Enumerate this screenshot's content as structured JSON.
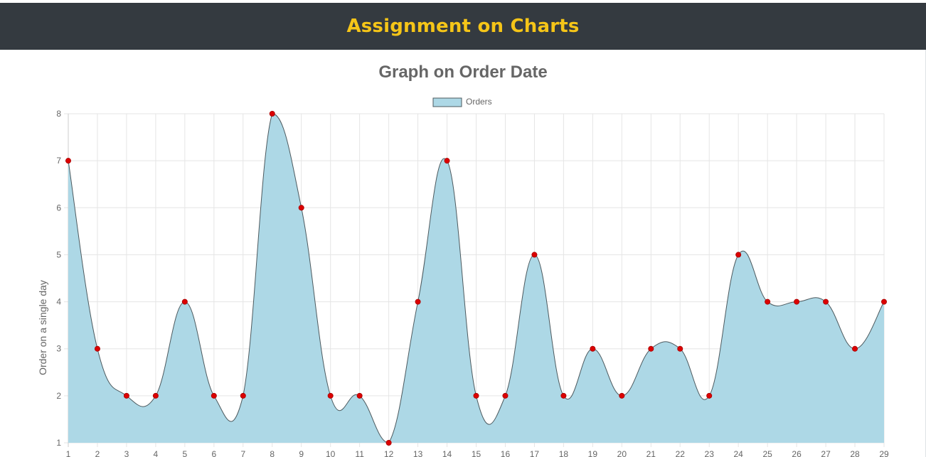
{
  "header": {
    "title": "Assignment on Charts"
  },
  "colors": {
    "header_bg": "#343a40",
    "header_text": "#f5c518",
    "area_fill": "#add8e6",
    "line": "#4d5a5f",
    "point": "#dd0000",
    "grid": "#e5e5e5",
    "text": "#666666"
  },
  "chart_data": {
    "type": "area",
    "title": "Graph on Order Date",
    "xlabel": "",
    "ylabel": "Order on a single day",
    "ylim": [
      1,
      8
    ],
    "yticks": [
      "1",
      "2",
      "3",
      "4",
      "5",
      "6",
      "7",
      "8"
    ],
    "legend_position": "top",
    "grid": true,
    "categories": [
      "1",
      "2",
      "3",
      "4",
      "5",
      "6",
      "7",
      "8",
      "9",
      "10",
      "11",
      "12",
      "13",
      "14",
      "15",
      "16",
      "17",
      "18",
      "19",
      "20",
      "21",
      "22",
      "23",
      "24",
      "25",
      "26",
      "27",
      "28",
      "29"
    ],
    "series": [
      {
        "name": "Orders",
        "values": [
          7,
          3,
          2,
          2,
          4,
          2,
          2,
          8,
          6,
          2,
          2,
          1,
          4,
          7,
          2,
          2,
          5,
          2,
          3,
          2,
          3,
          3,
          2,
          5,
          4,
          4,
          4,
          3,
          4
        ]
      }
    ]
  }
}
